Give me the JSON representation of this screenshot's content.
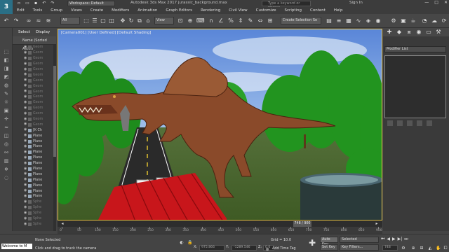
{
  "app": {
    "logo": "3",
    "workspace": "Workspace: Default",
    "title": "Autodesk 3ds Max 2017    jurassic_background.max",
    "search_placeholder": "Type a keyword or phrase",
    "sign_in": "Sign In",
    "window_buttons": [
      "—",
      "□",
      "✕"
    ]
  },
  "menu": [
    "Edit",
    "Tools",
    "Group",
    "Views",
    "Create",
    "Modifiers",
    "Animation",
    "Graph Editors",
    "Rendering",
    "Civil View",
    "Customize",
    "Scripting",
    "Content",
    "Help"
  ],
  "toolbar": {
    "filter_value": "All",
    "view_value": "View",
    "selection_set_placeholder": "Create Selection Se"
  },
  "scene_explorer": {
    "tabs": [
      "Select",
      "Display"
    ],
    "column_header": "Name (Sorted Ascen",
    "items": [
      {
        "name": "Geom",
        "dim": true
      },
      {
        "name": "Geom",
        "dim": true
      },
      {
        "name": "Geom",
        "dim": true
      },
      {
        "name": "Geom",
        "dim": true
      },
      {
        "name": "Geom",
        "dim": true
      },
      {
        "name": "Geom",
        "dim": true
      },
      {
        "name": "Geom",
        "dim": true
      },
      {
        "name": "Geom",
        "dim": true
      },
      {
        "name": "Geom",
        "dim": true
      },
      {
        "name": "Geom",
        "dim": true
      },
      {
        "name": "Geom",
        "dim": true
      },
      {
        "name": "Geom",
        "dim": true
      },
      {
        "name": "Geom",
        "dim": true
      },
      {
        "name": "Geom",
        "dim": true
      },
      {
        "name": "Geom",
        "dim": true
      },
      {
        "name": "[K Ch",
        "dim": false
      },
      {
        "name": "Plane",
        "dim": false
      },
      {
        "name": "Plane",
        "dim": false
      },
      {
        "name": "Plane",
        "dim": false
      },
      {
        "name": "Plane",
        "dim": false
      },
      {
        "name": "Plane",
        "dim": false
      },
      {
        "name": "Plane",
        "dim": false
      },
      {
        "name": "Plane",
        "dim": false
      },
      {
        "name": "Plane",
        "dim": false
      },
      {
        "name": "Plane",
        "dim": false
      },
      {
        "name": "Plane",
        "dim": false
      },
      {
        "name": "Plane",
        "dim": false
      },
      {
        "name": "Plane",
        "dim": false
      },
      {
        "name": "Sphe",
        "dim": true
      },
      {
        "name": "Sphe",
        "dim": true
      },
      {
        "name": "Sphe",
        "dim": true
      },
      {
        "name": "Sphe",
        "dim": true
      },
      {
        "name": "Sphe",
        "dim": true
      }
    ]
  },
  "viewport": {
    "label": "[Camera001] [User Defined] [Default Shading]"
  },
  "command_panel": {
    "modifier_list": "Modifier List"
  },
  "timeline": {
    "slider_text": "748 / 900",
    "ticks": [
      "0",
      "50",
      "100",
      "150",
      "200",
      "250",
      "300",
      "350",
      "400",
      "450",
      "500",
      "550",
      "600",
      "650",
      "700",
      "750",
      "800",
      "850",
      "900"
    ]
  },
  "status": {
    "maxscript_text": "Welcome to M",
    "selection": "None Selected",
    "prompt": "Click and drag to truck the camera",
    "x_label": "X:",
    "x_value": "975.866",
    "y_label": "Y:",
    "y_value": "-1289.546",
    "z_label": "Z:",
    "z_value": "0.0",
    "grid": "Grid = 10.0",
    "add_time_tag": "Add Time Tag",
    "auto_key": "Auto Key",
    "set_key": "Set Key",
    "selected_dropdown": "Selected",
    "key_filters": "Key Filters...",
    "frame": "748"
  },
  "colors": {
    "sky": "#7fb2ec",
    "grass": "#4d6b2a",
    "trees": "#1f8a1a",
    "dinosaur": "#8a4a2a",
    "road": "#2a2a2a",
    "red_roof": "#c8161b",
    "highlight": "#e8c34a"
  }
}
